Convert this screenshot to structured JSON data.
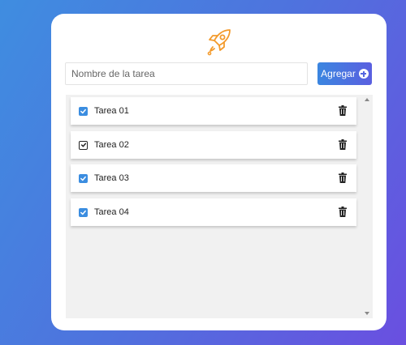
{
  "app": {
    "logo_icon": "rocket-icon",
    "logo_color": "#f39a2b"
  },
  "form": {
    "input_value": "",
    "input_placeholder": "Nombre de la tarea",
    "add_label": "Agregar",
    "add_icon": "plus-circle-icon"
  },
  "tasks": [
    {
      "label": "Tarea 01",
      "checked": true,
      "checkbox_style": "blue"
    },
    {
      "label": "Tarea 02",
      "checked": true,
      "checkbox_style": "dark"
    },
    {
      "label": "Tarea 03",
      "checked": true,
      "checkbox_style": "blue"
    },
    {
      "label": "Tarea 04",
      "checked": true,
      "checkbox_style": "blue"
    }
  ],
  "colors": {
    "accent_start": "#3b86e0",
    "accent_end": "#5a5fe0",
    "checkbox_blue": "#3b8de0"
  }
}
